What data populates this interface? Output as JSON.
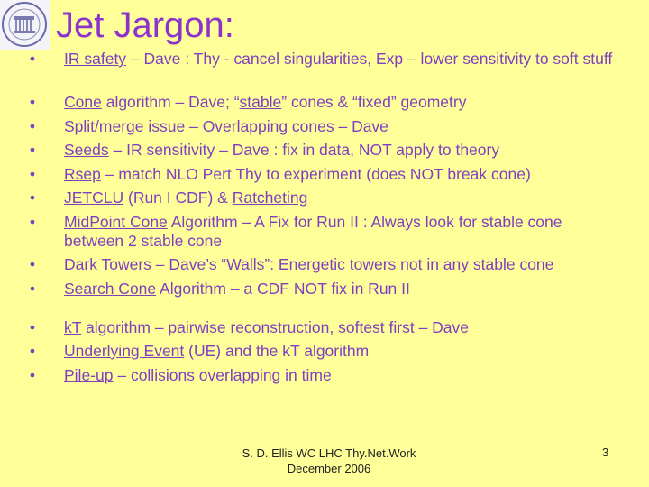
{
  "title": "Jet Jargon:",
  "logo_icon": "university-seal-icon",
  "groups": [
    {
      "items": [
        {
          "term": "IR safety",
          "rest": " – Dave : Thy - cancel singularities, Exp – lower sensitivity to soft stuff"
        }
      ]
    },
    {
      "items": [
        {
          "term": "Cone",
          "rest": " algorithm – Dave; “",
          "term2": "stable",
          "rest2": "” cones & “fixed” geometry"
        },
        {
          "term": "Split/merge",
          "rest": " issue – Overlapping cones – Dave"
        },
        {
          "term": "Seeds",
          "rest": " – IR sensitivity – Dave : fix in data, NOT apply to theory"
        },
        {
          "term": "Rsep",
          "rest": " – match NLO Pert Thy to experiment (does NOT break cone)"
        },
        {
          "term": "JETCLU",
          "rest": " (Run I CDF) & ",
          "term2": "Ratcheting",
          "rest2": ""
        },
        {
          "term": "MidPoint Cone",
          "rest": " Algorithm – A Fix for Run II : Always look for stable cone between 2 stable cone"
        },
        {
          "term": "Dark Towers",
          "rest": " – Dave’s “Walls”: Energetic towers not in any stable cone"
        },
        {
          "term": "Search Cone",
          "rest": " Algorithm – a CDF NOT fix in Run II"
        }
      ]
    },
    {
      "items": [
        {
          "term": "kT",
          "rest": " algorithm – pairwise reconstruction, softest first – Dave"
        },
        {
          "term": "Underlying Event",
          "rest": " (UE) and the kT algorithm"
        },
        {
          "term": "Pile-up",
          "rest": " – collisions overlapping in time"
        }
      ]
    }
  ],
  "bullet": "•",
  "footer": {
    "line1": "S. D. Ellis   WC LHC Thy.Net.Work",
    "line2": "December 2006",
    "page": "3"
  }
}
